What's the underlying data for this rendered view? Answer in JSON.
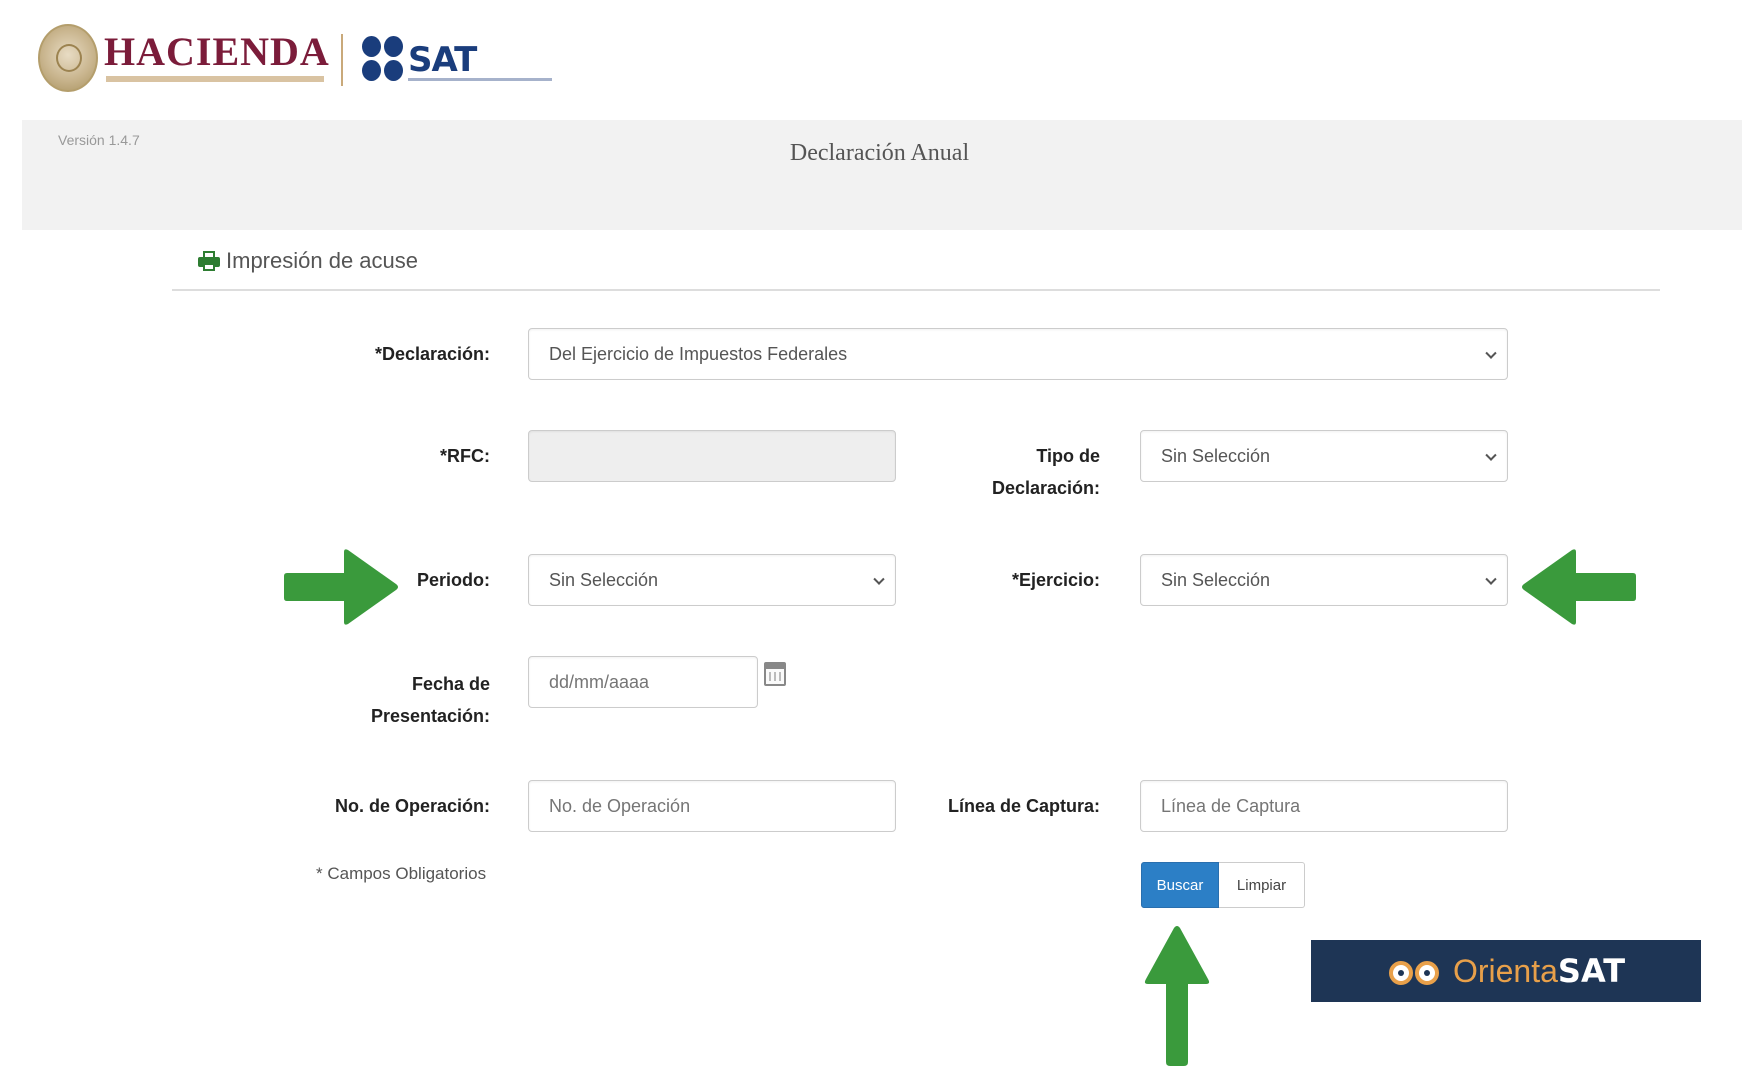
{
  "header": {
    "brand_left": "HACIENDA",
    "brand_right": "SAT"
  },
  "title_band": {
    "version": "Versión 1.4.7",
    "title": "Declaración Anual"
  },
  "section": {
    "title": "Impresión de acuse",
    "icon": "printer-icon"
  },
  "form": {
    "declaracion": {
      "label": "*Declaración:",
      "value": "Del Ejercicio de Impuestos Federales"
    },
    "rfc": {
      "label": "*RFC:",
      "value": ""
    },
    "tipo_declaracion": {
      "label": "Tipo de Declaración:",
      "value": "Sin Selección"
    },
    "periodo": {
      "label": "Periodo:",
      "value": "Sin Selección"
    },
    "ejercicio": {
      "label": "*Ejercicio:",
      "value": "Sin Selección"
    },
    "fecha_presentacion": {
      "label": "Fecha de Presentación:",
      "placeholder": "dd/mm/aaaa"
    },
    "no_operacion": {
      "label": "No. de Operación:",
      "placeholder": "No. de Operación"
    },
    "linea_captura": {
      "label": "Línea de Captura:",
      "placeholder": "Línea de Captura"
    },
    "required_note": "* Campos Obligatorios"
  },
  "buttons": {
    "search": "Buscar",
    "clear": "Limpiar"
  },
  "banner": {
    "text_orienta": "Orienta",
    "text_sat": "SAT"
  },
  "colors": {
    "brand_hacienda": "#7b1c3a",
    "brand_sat": "#1a3d7c",
    "primary_button": "#2c7fc6",
    "annotation_arrow": "#3a9a3c",
    "banner_bg": "#1e3555"
  }
}
